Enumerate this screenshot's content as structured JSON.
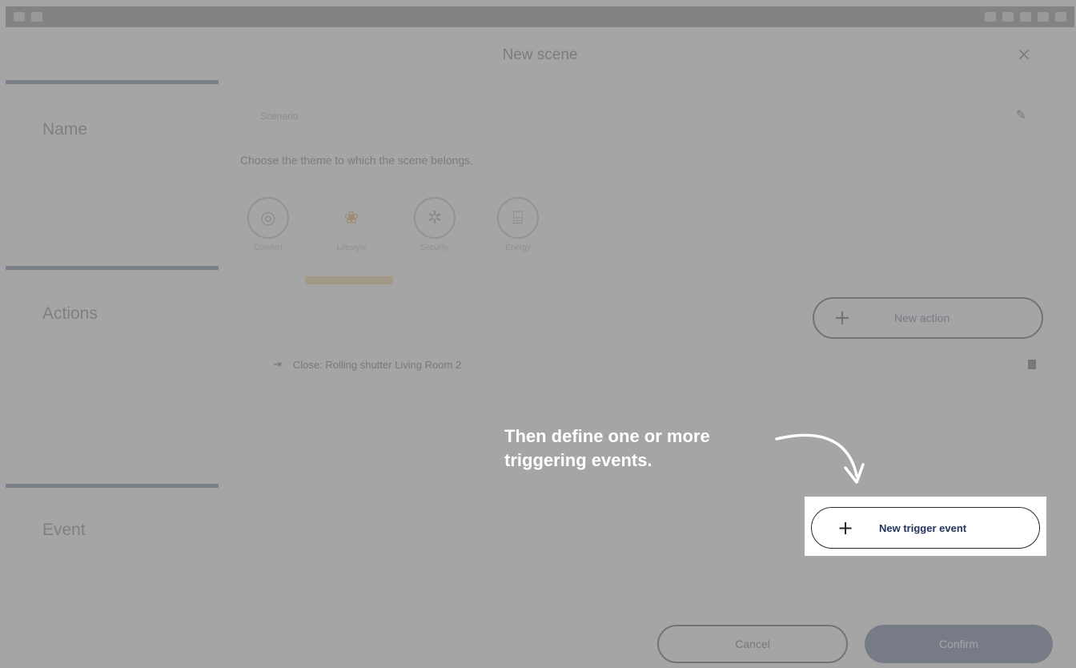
{
  "window": {
    "title": "New scene",
    "close_glyph": "×"
  },
  "sections": {
    "name_label": "Name",
    "actions_label": "Actions",
    "event_label": "Event"
  },
  "name_field": {
    "value": "Scenario"
  },
  "theme": {
    "hint": "Choose the theme to which the scene belongs.",
    "items": [
      {
        "icon": "comfort-icon",
        "glyph": "◎",
        "label": "Comfort"
      },
      {
        "icon": "people-icon",
        "glyph": "❀",
        "label": "Lifestyle"
      },
      {
        "icon": "security-icon",
        "glyph": "✲",
        "label": "Security"
      },
      {
        "icon": "energy-icon",
        "glyph": "⌸",
        "label": "Energy"
      }
    ],
    "selected_index": 1,
    "selected_color": "#e08a00"
  },
  "actions": {
    "new_action_label": "New action",
    "plus_glyph": "+",
    "items": [
      {
        "arrow": "⇥",
        "label": "Close: Rolling shutter Living Room 2"
      }
    ]
  },
  "event": {
    "new_trigger_label": "New trigger event",
    "plus_glyph": "+"
  },
  "footer": {
    "cancel_label": "Cancel",
    "confirm_label": "Confirm"
  },
  "callout": {
    "line1": "Then define one or more",
    "line2": "triggering events."
  },
  "colors": {
    "accent": "#2d4379",
    "section_line": "#3d4f78",
    "overlay": "rgba(140,140,140,0.78)"
  }
}
